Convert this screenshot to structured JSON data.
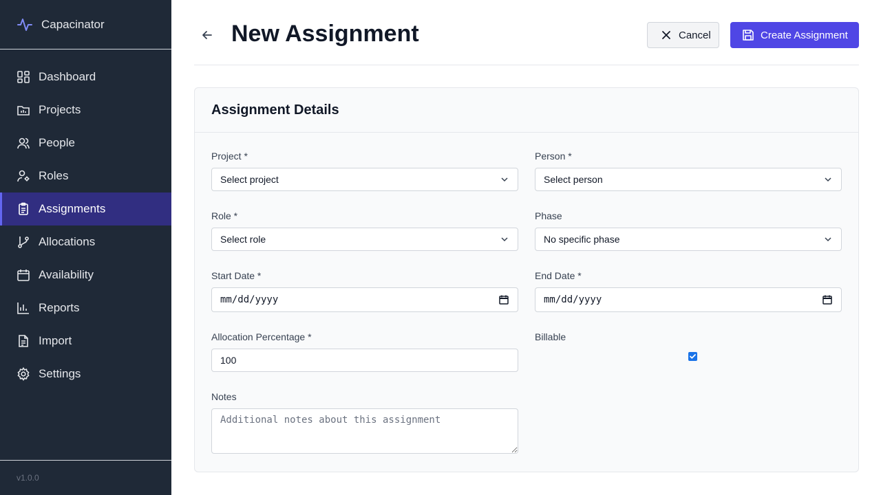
{
  "app": {
    "name": "Capacinator",
    "version": "v1.0.0"
  },
  "sidebar": {
    "items": [
      {
        "label": "Dashboard",
        "icon": "dashboard-icon"
      },
      {
        "label": "Projects",
        "icon": "projects-icon"
      },
      {
        "label": "People",
        "icon": "people-icon"
      },
      {
        "label": "Roles",
        "icon": "roles-icon"
      },
      {
        "label": "Assignments",
        "icon": "assignments-icon",
        "active": true
      },
      {
        "label": "Allocations",
        "icon": "allocations-icon"
      },
      {
        "label": "Availability",
        "icon": "calendar-icon"
      },
      {
        "label": "Reports",
        "icon": "reports-icon"
      },
      {
        "label": "Import",
        "icon": "import-icon"
      },
      {
        "label": "Settings",
        "icon": "gear-icon"
      }
    ]
  },
  "header": {
    "title": "New Assignment",
    "cancel_label": "Cancel",
    "create_label": "Create Assignment"
  },
  "form": {
    "section_title": "Assignment Details",
    "project": {
      "label": "Project *",
      "value": "Select project"
    },
    "person": {
      "label": "Person *",
      "value": "Select person"
    },
    "role": {
      "label": "Role *",
      "value": "Select role"
    },
    "phase": {
      "label": "Phase",
      "value": "No specific phase"
    },
    "start_date": {
      "label": "Start Date *",
      "value": "mm/dd/yyyy"
    },
    "end_date": {
      "label": "End Date *",
      "value": "mm/dd/yyyy"
    },
    "allocation": {
      "label": "Allocation Percentage *",
      "value": "100"
    },
    "billable": {
      "label": "Billable",
      "checked": true
    },
    "notes": {
      "label": "Notes",
      "placeholder": "Additional notes about this assignment"
    }
  },
  "colors": {
    "accent": "#4f46e5",
    "sidebar_bg": "#1f2937",
    "active_bg": "#312e81"
  }
}
